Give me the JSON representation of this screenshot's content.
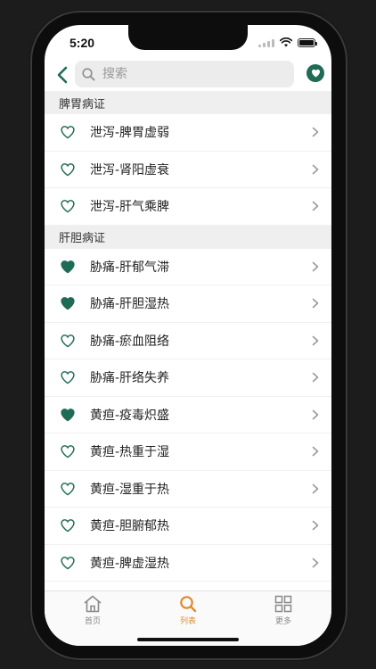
{
  "status": {
    "time": "5:20"
  },
  "search": {
    "placeholder": "搜索",
    "value": ""
  },
  "colors": {
    "accent": "#1f6b55",
    "active_tab": "#e08a2e"
  },
  "sections": [
    {
      "title": "脾胃病证",
      "items": [
        {
          "label": "泄泻-脾胃虚弱",
          "favorited": false
        },
        {
          "label": "泄泻-肾阳虚衰",
          "favorited": false
        },
        {
          "label": "泄泻-肝气乘脾",
          "favorited": false
        }
      ]
    },
    {
      "title": "肝胆病证",
      "items": [
        {
          "label": "胁痛-肝郁气滞",
          "favorited": true
        },
        {
          "label": "胁痛-肝胆湿热",
          "favorited": true
        },
        {
          "label": "胁痛-瘀血阻络",
          "favorited": false
        },
        {
          "label": "胁痛-肝络失养",
          "favorited": false
        },
        {
          "label": "黄疸-疫毒炽盛",
          "favorited": true
        },
        {
          "label": "黄疸-热重于湿",
          "favorited": false
        },
        {
          "label": "黄疸-湿重于热",
          "favorited": false
        },
        {
          "label": "黄疸-胆腑郁热",
          "favorited": false
        },
        {
          "label": "黄疸-脾虚湿热",
          "favorited": false
        }
      ]
    }
  ],
  "tabs": [
    {
      "label": "首页",
      "icon": "home-icon",
      "active": false
    },
    {
      "label": "列表",
      "icon": "search-icon",
      "active": true
    },
    {
      "label": "更多",
      "icon": "grid-icon",
      "active": false
    }
  ]
}
